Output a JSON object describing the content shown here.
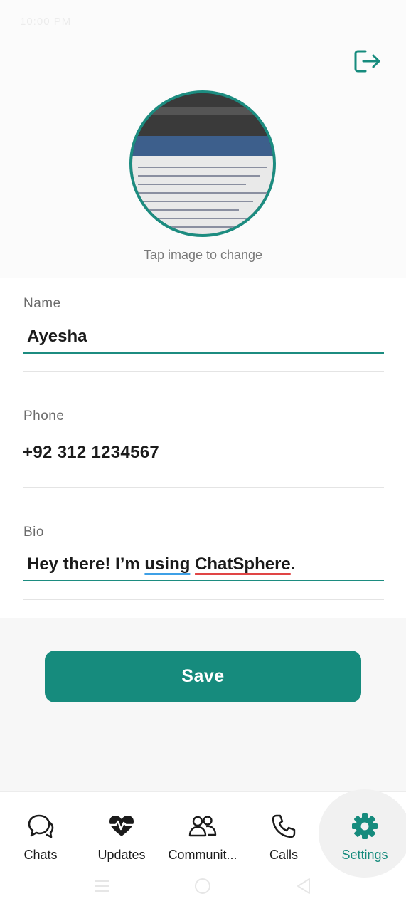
{
  "status_bar": {
    "left_text": "10:00 PM",
    "right_text": ""
  },
  "profile": {
    "tap_hint": "Tap image to change"
  },
  "fields": {
    "name": {
      "label": "Name",
      "value": "Ayesha"
    },
    "phone": {
      "label": "Phone",
      "value": "+92 312 1234567"
    },
    "bio": {
      "label": "Bio",
      "value_parts": [
        "Hey there! I’m ",
        "using",
        " ",
        "ChatSphere",
        "."
      ]
    }
  },
  "actions": {
    "save_label": "Save"
  },
  "nav": {
    "items": [
      {
        "label": "Chats",
        "icon": "chat-bubbles-icon"
      },
      {
        "label": "Updates",
        "icon": "heartbeat-icon"
      },
      {
        "label": "Communit...",
        "icon": "people-icon"
      },
      {
        "label": "Calls",
        "icon": "phone-icon"
      },
      {
        "label": "Settings",
        "icon": "gear-icon",
        "active": true
      }
    ]
  },
  "colors": {
    "accent": "#168b7d",
    "avatar_border": "#1c8c80",
    "underline_blue": "#3ea0e6",
    "underline_red": "#e04545"
  }
}
